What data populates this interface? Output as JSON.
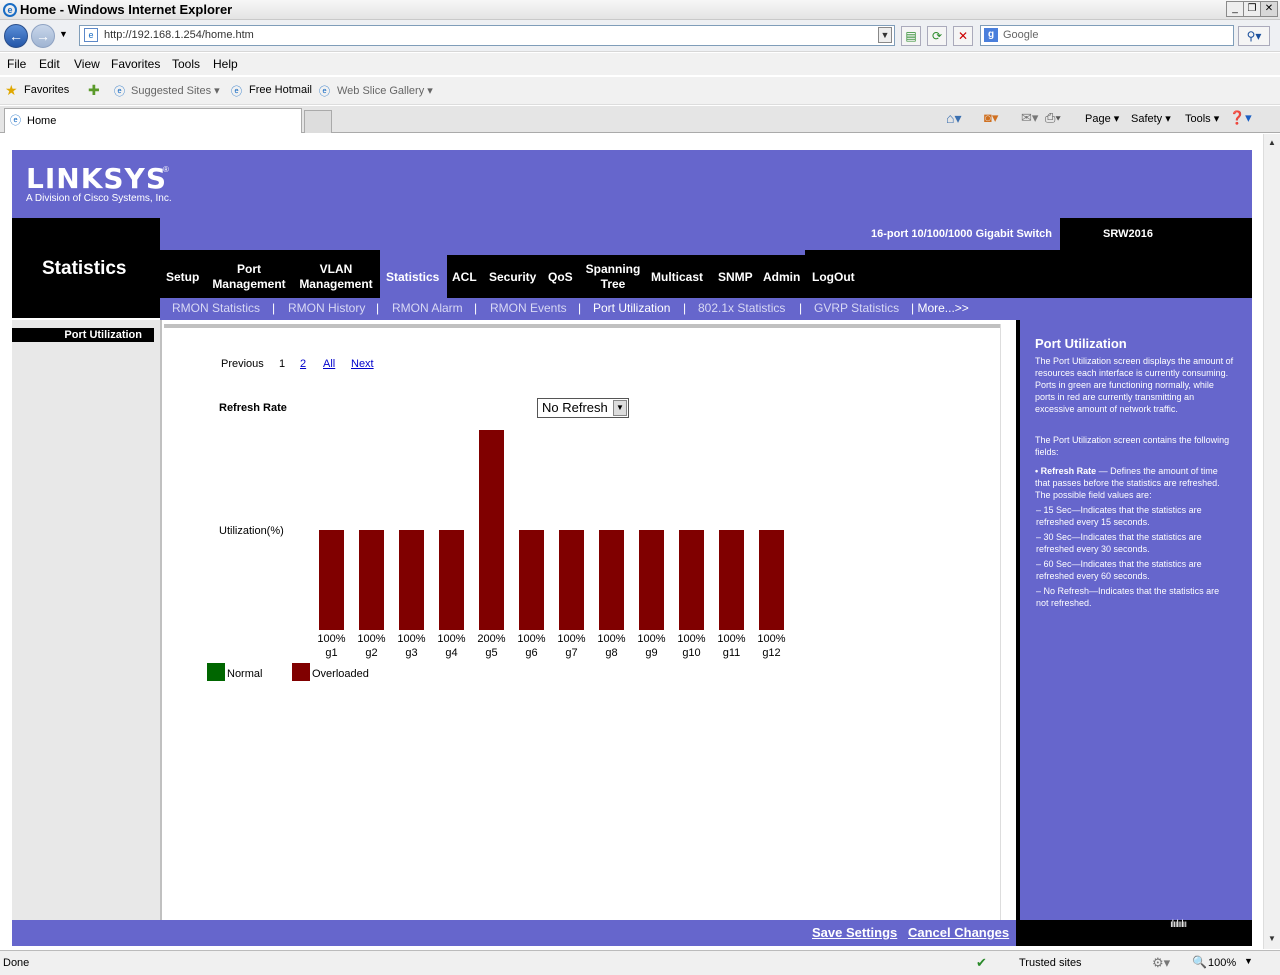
{
  "browser": {
    "window_title": "Home - Windows Internet Explorer",
    "url": "http://192.168.1.254/home.htm",
    "search_placeholder": "Google",
    "menu": [
      "File",
      "Edit",
      "View",
      "Favorites",
      "Tools",
      "Help"
    ],
    "favorites_label": "Favorites",
    "fav_items": [
      "Suggested Sites ▾",
      "Free Hotmail",
      "Web Slice Gallery ▾"
    ],
    "tab_title": "Home",
    "cmd_items": [
      "Page ▾",
      "Safety ▾",
      "Tools ▾"
    ],
    "status_text": "Done",
    "zone": "Trusted sites",
    "zoom": "100%"
  },
  "page": {
    "logo": "LINKSYS",
    "logo_sub": "A Division of Cisco Systems, Inc.",
    "product": "16-port 10/100/1000 Gigabit Switch",
    "model": "SRW2016",
    "section": "Statistics",
    "tabs": [
      "Setup",
      "Port\nManagement",
      "VLAN\nManagement",
      "Statistics",
      "ACL",
      "Security",
      "QoS",
      "Spanning\nTree",
      "Multicast",
      "SNMP",
      "Admin",
      "LogOut"
    ],
    "subnav": [
      "RMON Statistics",
      "RMON History",
      "RMON Alarm",
      "RMON Events",
      "Port Utilization",
      "802.1x Statistics",
      "GVRP Statistics",
      "| More...>>"
    ],
    "left_label": "Port Utilization",
    "pager": {
      "previous": "Previous",
      "current": "1",
      "page2": "2",
      "all": "All",
      "next": "Next"
    },
    "refresh_label": "Refresh Rate",
    "refresh_value": "No Refresh",
    "util_label": "Utilization(%)",
    "legend": {
      "normal": "Normal",
      "overloaded": "Overloaded"
    },
    "save": "Save Settings",
    "cancel": "Cancel Changes"
  },
  "help": {
    "title": "Port Utilization",
    "p1": "The Port Utilization screen displays the amount of resources each interface is currently consuming. Ports in green are functioning normally, while ports in red are currently transmitting an excessive amount of network traffic.",
    "p2": "The Port Utilization screen contains the following fields:",
    "p3_bold": "• Refresh Rate",
    "p3": " — Defines the amount of time that passes before the statistics are refreshed. The possible field values are:",
    "opt1": "– 15 Sec—Indicates that the statistics are refreshed every 15 seconds.",
    "opt2": "– 30 Sec—Indicates that the statistics are refreshed every 30 seconds.",
    "opt3": "– 60 Sec—Indicates that the statistics are refreshed every 60 seconds.",
    "opt4": "– No Refresh—Indicates that the statistics are not refreshed."
  },
  "chart_data": {
    "type": "bar",
    "categories": [
      "g1",
      "g2",
      "g3",
      "g4",
      "g5",
      "g6",
      "g7",
      "g8",
      "g9",
      "g10",
      "g11",
      "g12"
    ],
    "values": [
      100,
      100,
      100,
      100,
      200,
      100,
      100,
      100,
      100,
      100,
      100,
      100
    ],
    "labels": [
      "100%",
      "100%",
      "100%",
      "100%",
      "200%",
      "100%",
      "100%",
      "100%",
      "100%",
      "100%",
      "100%",
      "100%"
    ],
    "ylabel": "Utilization(%)",
    "ylim": [
      0,
      200
    ],
    "colors": {
      "overloaded": "#800000",
      "normal": "#006600"
    },
    "legend": [
      "Normal",
      "Overloaded"
    ]
  }
}
